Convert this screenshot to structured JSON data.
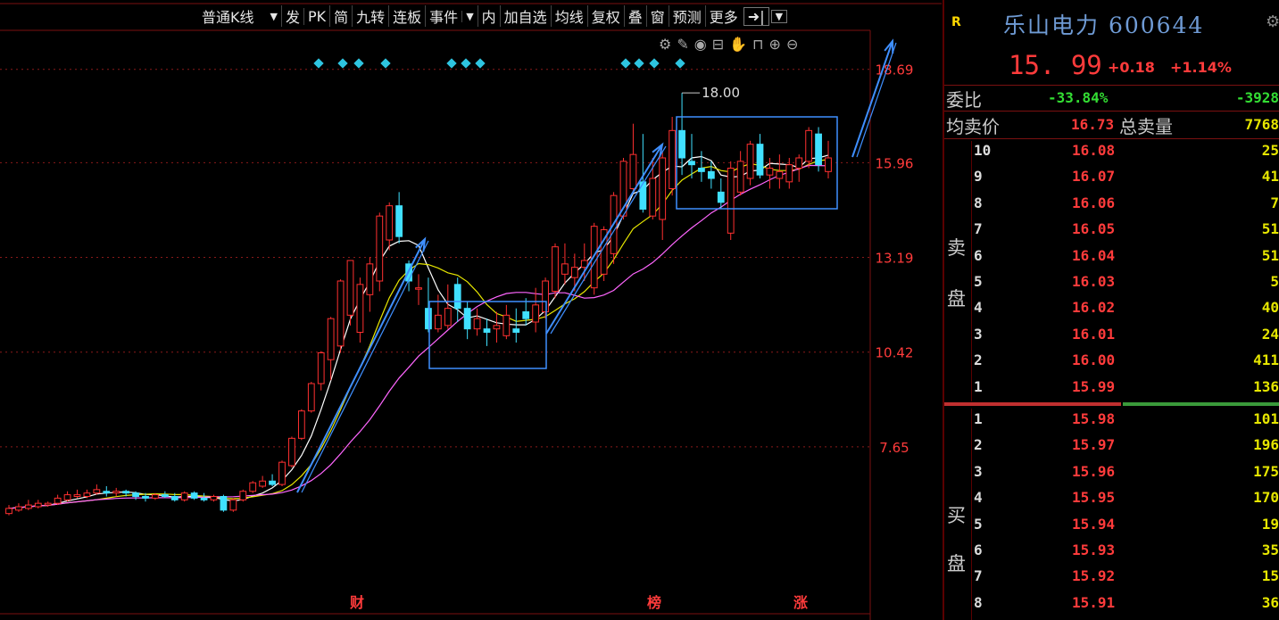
{
  "toolbar": {
    "kline_type": "普通K线",
    "items": [
      "发",
      "PK",
      "简",
      "九转",
      "连板",
      "事件",
      "内",
      "加自选",
      "均线",
      "复权",
      "叠",
      "窗",
      "预测",
      "更多"
    ]
  },
  "tool_icons": [
    "settings-icon",
    "draw-icon",
    "eye-icon",
    "lock-open-icon",
    "hand-icon",
    "lock-icon",
    "zoom-in-icon",
    "zoom-out-icon"
  ],
  "chart_data": {
    "type": "candlestick",
    "y_axis_ticks": [
      "7.65",
      "10.42",
      "13.19",
      "15.96",
      "18.69"
    ],
    "ylim": [
      4.7,
      19.1
    ],
    "colors": {
      "up": "#ff3030",
      "down": "#40e0ff",
      "ma5": "#ffffff",
      "ma10": "#e6e600",
      "ma20": "#ff66ff",
      "annotation": "#3f8fff"
    },
    "marker_max": "18.00",
    "bottom_markers": [
      "财",
      "榜",
      "涨"
    ],
    "candles": [
      {
        "o": 5.7,
        "c": 5.85,
        "h": 5.95,
        "l": 5.65
      },
      {
        "o": 5.8,
        "c": 5.9,
        "h": 6.0,
        "l": 5.75
      },
      {
        "o": 5.85,
        "c": 5.95,
        "h": 6.1,
        "l": 5.8
      },
      {
        "o": 5.9,
        "c": 6.0,
        "h": 6.1,
        "l": 5.85
      },
      {
        "o": 5.95,
        "c": 6.0,
        "h": 6.05,
        "l": 5.9
      },
      {
        "o": 6.0,
        "c": 6.15,
        "h": 6.25,
        "l": 5.95
      },
      {
        "o": 6.1,
        "c": 6.25,
        "h": 6.35,
        "l": 6.05
      },
      {
        "o": 6.2,
        "c": 6.25,
        "h": 6.4,
        "l": 6.15
      },
      {
        "o": 6.2,
        "c": 6.3,
        "h": 6.4,
        "l": 6.15
      },
      {
        "o": 6.3,
        "c": 6.4,
        "h": 6.55,
        "l": 6.25
      },
      {
        "o": 6.35,
        "c": 6.3,
        "h": 6.5,
        "l": 6.2
      },
      {
        "o": 6.3,
        "c": 6.35,
        "h": 6.45,
        "l": 6.2
      },
      {
        "o": 6.35,
        "c": 6.3,
        "h": 6.4,
        "l": 6.2
      },
      {
        "o": 6.3,
        "c": 6.2,
        "h": 6.35,
        "l": 6.1
      },
      {
        "o": 6.2,
        "c": 6.15,
        "h": 6.3,
        "l": 6.05
      },
      {
        "o": 6.15,
        "c": 6.25,
        "h": 6.3,
        "l": 6.1
      },
      {
        "o": 6.25,
        "c": 6.2,
        "h": 6.35,
        "l": 6.15
      },
      {
        "o": 6.2,
        "c": 6.1,
        "h": 6.3,
        "l": 6.05
      },
      {
        "o": 6.1,
        "c": 6.3,
        "h": 6.35,
        "l": 6.05
      },
      {
        "o": 6.3,
        "c": 6.15,
        "h": 6.35,
        "l": 6.1
      },
      {
        "o": 6.15,
        "c": 6.1,
        "h": 6.3,
        "l": 6.05
      },
      {
        "o": 6.1,
        "c": 6.2,
        "h": 6.25,
        "l": 6.05
      },
      {
        "o": 6.2,
        "c": 5.8,
        "h": 6.25,
        "l": 5.75
      },
      {
        "o": 5.8,
        "c": 6.1,
        "h": 6.15,
        "l": 5.75
      },
      {
        "o": 6.1,
        "c": 6.35,
        "h": 6.4,
        "l": 6.05
      },
      {
        "o": 6.35,
        "c": 6.6,
        "h": 6.65,
        "l": 6.3
      },
      {
        "o": 6.5,
        "c": 6.65,
        "h": 6.8,
        "l": 6.45
      },
      {
        "o": 6.65,
        "c": 6.55,
        "h": 6.85,
        "l": 6.5
      },
      {
        "o": 6.55,
        "c": 7.2,
        "h": 7.25,
        "l": 6.5
      },
      {
        "o": 7.1,
        "c": 7.9,
        "h": 7.95,
        "l": 7.05
      },
      {
        "o": 7.9,
        "c": 8.7,
        "h": 8.75,
        "l": 7.85
      },
      {
        "o": 8.7,
        "c": 9.5,
        "h": 9.55,
        "l": 8.65
      },
      {
        "o": 9.5,
        "c": 10.4,
        "h": 10.45,
        "l": 9.3
      },
      {
        "o": 10.2,
        "c": 11.4,
        "h": 11.45,
        "l": 9.6
      },
      {
        "o": 10.6,
        "c": 12.5,
        "h": 12.55,
        "l": 10.4
      },
      {
        "o": 11.5,
        "c": 13.1,
        "h": 13.1,
        "l": 11.2
      },
      {
        "o": 11.0,
        "c": 12.4,
        "h": 12.6,
        "l": 10.7
      },
      {
        "o": 12.1,
        "c": 13.0,
        "h": 13.2,
        "l": 11.6
      },
      {
        "o": 12.5,
        "c": 14.4,
        "h": 14.5,
        "l": 12.2
      },
      {
        "o": 13.7,
        "c": 14.7,
        "h": 14.8,
        "l": 13.4
      },
      {
        "o": 14.7,
        "c": 13.8,
        "h": 15.1,
        "l": 13.6
      },
      {
        "o": 13.0,
        "c": 12.5,
        "h": 13.1,
        "l": 12.2
      },
      {
        "o": 12.3,
        "c": 12.3,
        "h": 12.7,
        "l": 11.8
      },
      {
        "o": 11.7,
        "c": 11.1,
        "h": 12.6,
        "l": 11.0
      },
      {
        "o": 11.1,
        "c": 11.5,
        "h": 12.1,
        "l": 11.0
      },
      {
        "o": 11.2,
        "c": 11.7,
        "h": 12.4,
        "l": 11.1
      },
      {
        "o": 12.4,
        "c": 11.7,
        "h": 12.6,
        "l": 11.3
      },
      {
        "o": 11.7,
        "c": 11.1,
        "h": 11.9,
        "l": 10.8
      },
      {
        "o": 11.1,
        "c": 11.4,
        "h": 11.7,
        "l": 10.9
      },
      {
        "o": 11.1,
        "c": 11.0,
        "h": 11.4,
        "l": 10.6
      },
      {
        "o": 11.1,
        "c": 11.2,
        "h": 11.6,
        "l": 10.7
      },
      {
        "o": 10.9,
        "c": 11.5,
        "h": 11.8,
        "l": 10.8
      },
      {
        "o": 11.1,
        "c": 11.0,
        "h": 11.7,
        "l": 10.7
      },
      {
        "o": 11.6,
        "c": 11.4,
        "h": 12.0,
        "l": 11.2
      },
      {
        "o": 11.3,
        "c": 11.8,
        "h": 12.3,
        "l": 11.0
      },
      {
        "o": 11.6,
        "c": 12.5,
        "h": 12.6,
        "l": 11.4
      },
      {
        "o": 12.2,
        "c": 13.5,
        "h": 13.6,
        "l": 12.0
      },
      {
        "o": 12.7,
        "c": 13.0,
        "h": 13.6,
        "l": 12.4
      },
      {
        "o": 12.6,
        "c": 12.9,
        "h": 13.3,
        "l": 12.2
      },
      {
        "o": 12.9,
        "c": 13.1,
        "h": 13.6,
        "l": 12.5
      },
      {
        "o": 12.3,
        "c": 14.1,
        "h": 14.2,
        "l": 12.1
      },
      {
        "o": 12.7,
        "c": 14.0,
        "h": 14.1,
        "l": 12.5
      },
      {
        "o": 13.3,
        "c": 15.0,
        "h": 15.1,
        "l": 13.0
      },
      {
        "o": 14.4,
        "c": 16.0,
        "h": 16.1,
        "l": 14.3
      },
      {
        "o": 15.2,
        "c": 16.2,
        "h": 17.1,
        "l": 15.1
      },
      {
        "o": 15.4,
        "c": 14.6,
        "h": 16.8,
        "l": 14.5
      },
      {
        "o": 14.4,
        "c": 15.5,
        "h": 16.1,
        "l": 14.3
      },
      {
        "o": 14.3,
        "c": 16.1,
        "h": 16.3,
        "l": 13.7
      },
      {
        "o": 15.2,
        "c": 16.9,
        "h": 17.3,
        "l": 15.0
      },
      {
        "o": 16.9,
        "c": 16.1,
        "h": 18.0,
        "l": 15.6
      },
      {
        "o": 16.0,
        "c": 15.9,
        "h": 16.8,
        "l": 15.5
      },
      {
        "o": 15.8,
        "c": 15.7,
        "h": 16.3,
        "l": 15.4
      },
      {
        "o": 15.7,
        "c": 15.5,
        "h": 16.0,
        "l": 15.2
      },
      {
        "o": 15.1,
        "c": 14.8,
        "h": 15.5,
        "l": 14.6
      },
      {
        "o": 13.9,
        "c": 15.8,
        "h": 16.0,
        "l": 13.7
      },
      {
        "o": 15.1,
        "c": 16.0,
        "h": 16.3,
        "l": 15.0
      },
      {
        "o": 15.5,
        "c": 16.5,
        "h": 16.6,
        "l": 15.3
      },
      {
        "o": 16.5,
        "c": 15.6,
        "h": 16.8,
        "l": 15.5
      },
      {
        "o": 15.6,
        "c": 15.8,
        "h": 16.1,
        "l": 15.2
      },
      {
        "o": 15.5,
        "c": 15.7,
        "h": 16.2,
        "l": 15.2
      },
      {
        "o": 15.4,
        "c": 15.9,
        "h": 16.1,
        "l": 15.2
      },
      {
        "o": 15.8,
        "c": 16.1,
        "h": 16.2,
        "l": 15.4
      },
      {
        "o": 16.0,
        "c": 16.9,
        "h": 17.0,
        "l": 15.8
      },
      {
        "o": 16.8,
        "c": 15.9,
        "h": 17.0,
        "l": 15.7
      },
      {
        "o": 15.7,
        "c": 16.1,
        "h": 16.6,
        "l": 15.5
      }
    ]
  },
  "stock": {
    "tag": "R",
    "name": "乐山电力",
    "code": "600644",
    "price": "15. 99",
    "change": "+0.18",
    "pct": "+1.14%"
  },
  "weibi": {
    "label": "委比",
    "pct": "-33.84%",
    "diff": "-3928"
  },
  "avg_sell": {
    "label": "均卖价",
    "price": "16.73",
    "total_label": "总卖量",
    "total": "7768"
  },
  "sell_label": [
    "卖",
    "盘"
  ],
  "buy_label": [
    "买",
    "盘"
  ],
  "sells": [
    {
      "lvl": "10",
      "price": "16.08",
      "vol": "25"
    },
    {
      "lvl": "9",
      "price": "16.07",
      "vol": "41"
    },
    {
      "lvl": "8",
      "price": "16.06",
      "vol": "7"
    },
    {
      "lvl": "7",
      "price": "16.05",
      "vol": "51"
    },
    {
      "lvl": "6",
      "price": "16.04",
      "vol": "51"
    },
    {
      "lvl": "5",
      "price": "16.03",
      "vol": "5"
    },
    {
      "lvl": "4",
      "price": "16.02",
      "vol": "40"
    },
    {
      "lvl": "3",
      "price": "16.01",
      "vol": "24"
    },
    {
      "lvl": "2",
      "price": "16.00",
      "vol": "411"
    },
    {
      "lvl": "1",
      "price": "15.99",
      "vol": "136"
    }
  ],
  "buys": [
    {
      "lvl": "1",
      "price": "15.98",
      "vol": "101"
    },
    {
      "lvl": "2",
      "price": "15.97",
      "vol": "196"
    },
    {
      "lvl": "3",
      "price": "15.96",
      "vol": "175"
    },
    {
      "lvl": "4",
      "price": "15.95",
      "vol": "170"
    },
    {
      "lvl": "5",
      "price": "15.94",
      "vol": "19"
    },
    {
      "lvl": "6",
      "price": "15.93",
      "vol": "35"
    },
    {
      "lvl": "7",
      "price": "15.92",
      "vol": "15"
    },
    {
      "lvl": "8",
      "price": "15.91",
      "vol": "36"
    }
  ]
}
